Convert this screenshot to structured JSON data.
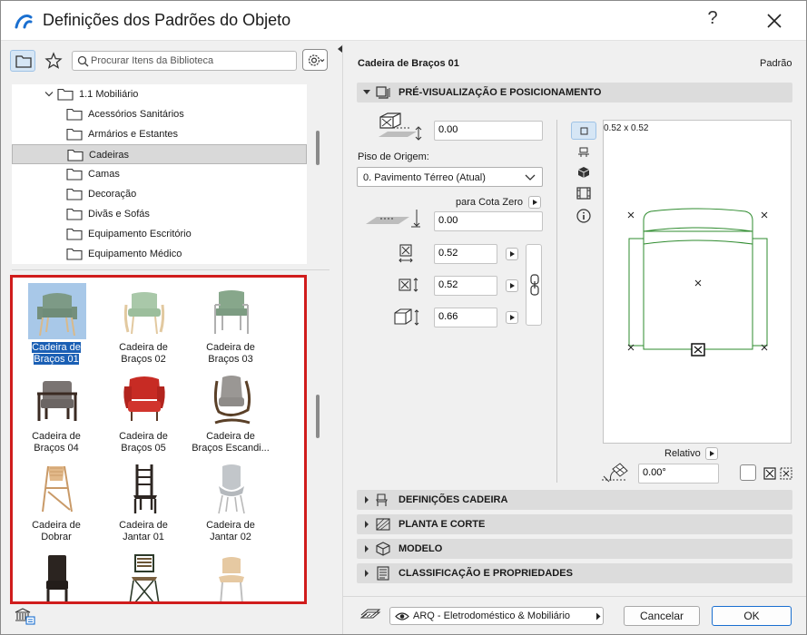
{
  "window": {
    "title": "Definições dos Padrões do Objeto",
    "help": "?"
  },
  "library": {
    "search_placeholder": "Procurar Itens da Biblioteca",
    "tree": [
      {
        "label": "1.1 Mobiliário",
        "expanded": true
      },
      {
        "label": "Acessórios Sanitários"
      },
      {
        "label": "Armários e Estantes"
      },
      {
        "label": "Cadeiras",
        "selected": true
      },
      {
        "label": "Camas"
      },
      {
        "label": "Decoração"
      },
      {
        "label": "Divãs e Sofás"
      },
      {
        "label": "Equipamento Escritório"
      },
      {
        "label": "Equipamento Médico"
      }
    ],
    "items": [
      {
        "line1": "Cadeira de",
        "line2": "Braços 01",
        "selected": true,
        "icon": "armchair-green-icon"
      },
      {
        "line1": "Cadeira de",
        "line2": "Braços 02",
        "icon": "armchair-mint-icon"
      },
      {
        "line1": "Cadeira de",
        "line2": "Braços 03",
        "icon": "armchair-metal-icon"
      },
      {
        "line1": "Cadeira de",
        "line2": "Braços 04",
        "icon": "armchair-wood-icon"
      },
      {
        "line1": "Cadeira de",
        "line2": "Braços 05",
        "icon": "wingchair-red-icon"
      },
      {
        "line1": "Cadeira de",
        "line2": "Braços Escandi...",
        "icon": "armchair-scandi-icon"
      },
      {
        "line1": "Cadeira de",
        "line2": "Dobrar",
        "icon": "folding-chair-icon"
      },
      {
        "line1": "Cadeira de",
        "line2": "Jantar 01",
        "icon": "dining-chair-dark-icon"
      },
      {
        "line1": "Cadeira de",
        "line2": "Jantar 02",
        "icon": "dining-chair-shell-icon"
      },
      {
        "line1": "",
        "line2": "",
        "icon": "dining-chair-leather-icon"
      },
      {
        "line1": "",
        "line2": "",
        "icon": "bistro-chair-icon"
      },
      {
        "line1": "",
        "line2": "",
        "icon": "dining-chair-light-icon"
      }
    ]
  },
  "settings": {
    "object_name": "Cadeira de Braços 01",
    "default_label": "Padrão",
    "preview_section": "PRÉ-VISUALIZAÇÃO E POSICIONAMENTO",
    "elevation_value": "0.00",
    "home_story_label": "Piso de Origem:",
    "home_story_value": "0. Pavimento Térreo (Atual)",
    "zero_ref_label": "para Cota Zero",
    "zero_elevation_value": "0.00",
    "width_value": "0.52",
    "depth_value": "0.52",
    "height_value": "0.66",
    "preview_size_label": "0.52 x 0.52",
    "relative_label": "Relativo",
    "angle_value": "0.00°",
    "sections": [
      {
        "title": "DEFINIÇÕES CADEIRA",
        "icon": "chair-settings-icon"
      },
      {
        "title": "PLANTA E CORTE",
        "icon": "floor-plan-icon"
      },
      {
        "title": "MODELO",
        "icon": "model-cube-icon"
      },
      {
        "title": "CLASSIFICAÇÃO E PROPRIEDADES",
        "icon": "classification-icon"
      }
    ]
  },
  "footer": {
    "layer_value": "ARQ - Eletrodoméstico & Mobiliário",
    "cancel_label": "Cancelar",
    "ok_label": "OK"
  },
  "colors": {
    "accent": "#1a5fb4",
    "highlight_border": "#d01c1c",
    "preview_line": "#2e8b2e"
  }
}
